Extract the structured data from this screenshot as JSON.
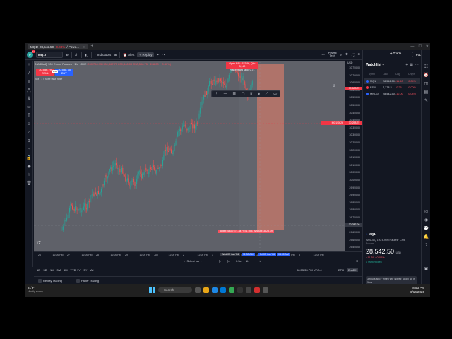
{
  "browser": {
    "tab_symbol": "MQ1!",
    "tab_price": "28,542.50",
    "tab_change": "-0.04%",
    "tab_suffix": "/ Powe...",
    "new_tab": "+"
  },
  "toolbar": {
    "avatar_initial": "P",
    "avatar_badge": "11",
    "symbol": "MQ1!",
    "interval": "1h",
    "indicators_label": "Indicators",
    "alert_label": "Alert",
    "replay_label": "Replay",
    "user_name": "Powell",
    "user_sub": "Tech",
    "trade_label": "Trade",
    "publish_label": "Publish"
  },
  "chart": {
    "header_text": "NASDAQ 100 E-mini Futures · 1h · CME",
    "header_ohlc": "O30,754.75 H30,867.75 L30,446.00 C30,508.75 −248.00 (−0.80%)",
    "indicator_text": "SMT 1 0 false false false",
    "sell_price": "30,556.75",
    "sell_label": "SELL",
    "buy_price": "30,558.75",
    "buy_label": "BUY",
    "spread": "2.00",
    "position_info_line1": "Open P&L: 157.90, Qty: 8,140",
    "position_info_line2": "Risk/reward ratio: 0.71",
    "target_info": "Target: 483.75 (1.347%) 1,935, Amount: 3828.19",
    "logo": "17"
  },
  "price_axis": {
    "labels": [
      "30,750.00",
      "30,700.00",
      "30,650.00",
      "30,600.00",
      "30,550.00",
      "30,500.00",
      "30,450.00",
      "30,400.00",
      "30,350.00",
      "30,300.00",
      "30,250.00",
      "30,200.00",
      "30,150.00",
      "30,100.00",
      "30,050.00",
      "30,000.00",
      "29,950.00",
      "29,900.00",
      "29,850.00",
      "29,800.00",
      "29,750.00",
      "29,700.00",
      "29,650.00",
      "29,600.00",
      "29,550.00"
    ],
    "current_tag": "30,508.75",
    "currency": "USD",
    "order_tag_label": "MQ1!0626",
    "order_tag_price": "30,258.75",
    "cursor_tag": "30,282.00"
  },
  "time_axis": {
    "labels": [
      "26",
      "12:00 PM",
      "27",
      "12:00 PM",
      "28",
      "12:00 PM",
      "29",
      "12:00 PM",
      "Jun",
      "12:00 PM",
      "2",
      "12:00 PM",
      "3",
      "12:00 PM",
      "4",
      "12:00 PM",
      "5",
      "12:00 PM",
      "8",
      "12:00 PM"
    ],
    "cursor_tag": "Wed 03 Jun '26",
    "cursor_time": "11:00 AM",
    "range_start": "Fri 05 Jun '26",
    "range_end": "04:00 AM"
  },
  "replay": {
    "select_bar": "Select bar",
    "speed": "0.5x",
    "interval": "1h"
  },
  "range": {
    "buttons": [
      "1D",
      "5D",
      "1M",
      "3M",
      "6M",
      "YTD",
      "1Y",
      "5Y",
      "All"
    ],
    "clock": "08:53:33 PM UTC-4",
    "session": "ETH",
    "adj": "B-ADJ"
  },
  "trading_panel": {
    "replay_trading": "Replay Trading",
    "paper_trading": "Paper Trading"
  },
  "watchlist": {
    "title": "Watchlist",
    "columns": [
      "Symb",
      "Last",
      "Chg",
      "Chg%"
    ],
    "rows": [
      {
        "symbol": "MQ1!",
        "last": "28,542.50",
        "chg": "-11.50",
        "chgp": "-0.04%",
        "color": "#2962ff"
      },
      {
        "symbol": "ES1!",
        "last": "7,278.2",
        "chg": "-0.25",
        "chgp": "-0.00%",
        "color": "#f23645"
      },
      {
        "symbol": "MNQ1!",
        "last": "28,542.50",
        "chg": "-12.00",
        "chgp": "-0.04%",
        "color": "#2962ff"
      }
    ],
    "detail_symbol": "MQ1!",
    "detail_name": "NASDAQ 100 E-mini Futures · CME",
    "detail_sub": "Futures",
    "detail_price": "28,542.50",
    "detail_currency": "USD",
    "detail_change": "−11.50  −0.04%",
    "detail_market": "● Market open",
    "news_text": "3 hours ago · When will 'Speed' Show Up in Your..."
  },
  "taskbar": {
    "weather_temp": "81°F",
    "weather_desc": "Mostly sunny",
    "search": "Search",
    "time": "8:53 PM",
    "date": "6/10/2026"
  }
}
